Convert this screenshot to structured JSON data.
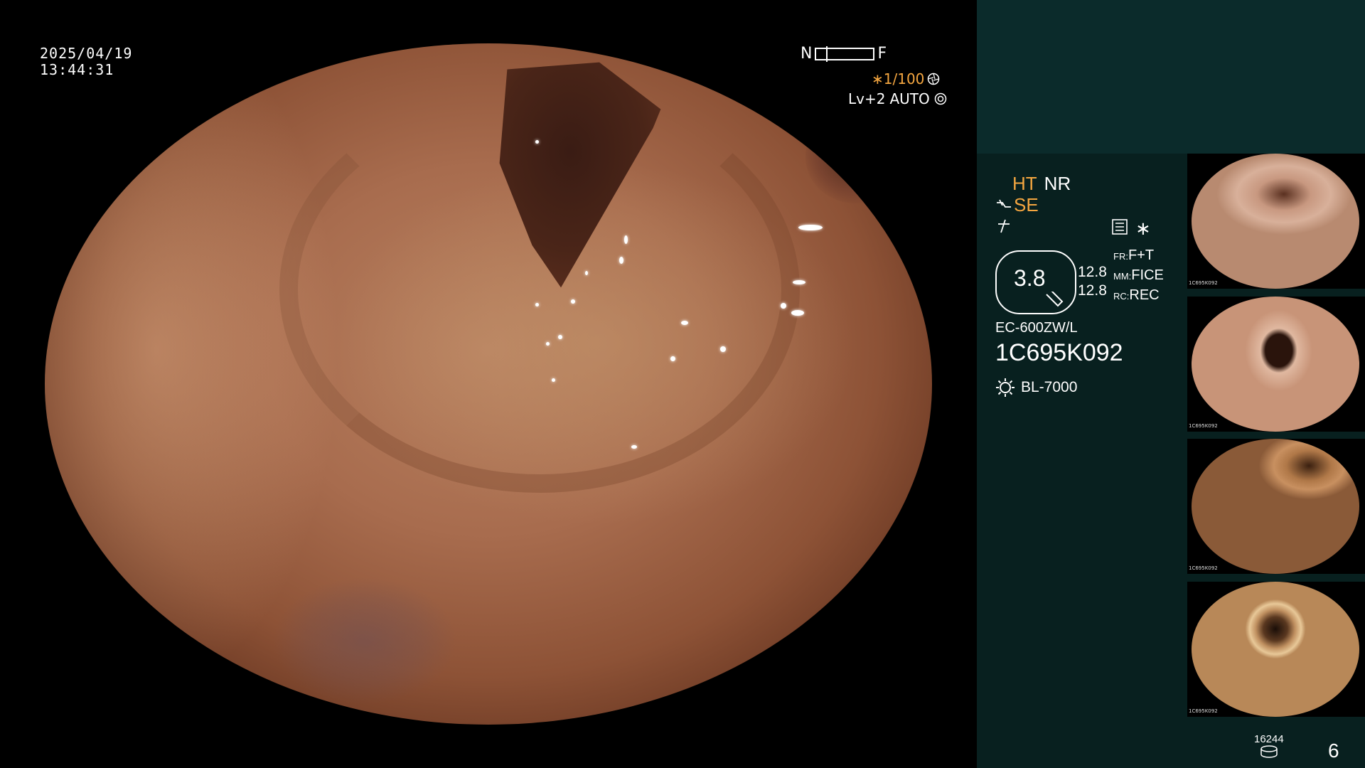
{
  "overlay": {
    "date": "2025/04/19",
    "time": "13:44:31",
    "focus_near": "N",
    "focus_far": "F",
    "shutter": "∗1/100",
    "level": "Lv+2",
    "exposure_mode": "AUTO"
  },
  "settings": {
    "ht": "HT",
    "nr": "NR",
    "se": "SE",
    "star": "∗",
    "zoom_value": "3.8",
    "mode_value_1": "12.8",
    "mode_value_2": "12.8",
    "fr_label": "FR:",
    "fr_value": "F+T",
    "mm_label": "MM:",
    "mm_value": "FICE",
    "rc_label": "RC:",
    "rc_value": "REC",
    "scope_model": "EC-600ZW/L",
    "scope_serial": "1C695K092",
    "light_source": "BL-7000"
  },
  "footer": {
    "image_count": "16244",
    "page_number": "6"
  },
  "thumbnails": [
    {
      "label": "1C695K092"
    },
    {
      "label": "1C695K092"
    },
    {
      "label": "1C695K092"
    },
    {
      "label": "1C695K092"
    }
  ],
  "colors": {
    "accent_orange": "#f4a640",
    "panel_bg": "#08201f",
    "panel_top_bg": "#0b2b2b"
  },
  "icons": [
    "shutter-icon",
    "auto-iris-icon",
    "scope-tip-icon",
    "freeze-icon",
    "menu-icon",
    "light-source-icon",
    "storage-icon"
  ]
}
